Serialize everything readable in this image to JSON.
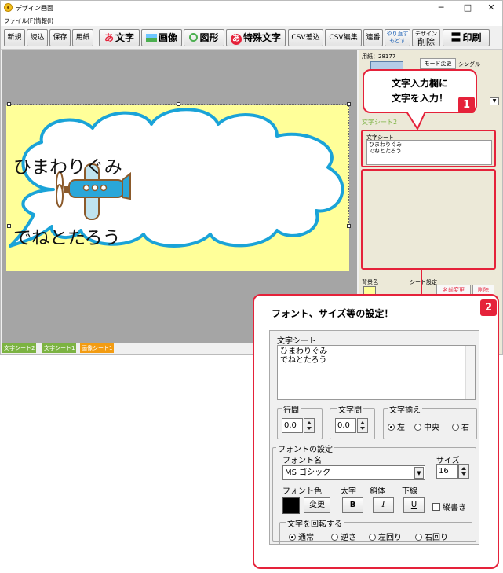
{
  "window": {
    "title": "デザイン画面",
    "controls": {
      "minimize": "─",
      "maximize": "□",
      "close": "✕"
    }
  },
  "menu": {
    "items": [
      "ファイル(F)",
      "情報(I)"
    ]
  },
  "toolbar": {
    "new": "新規",
    "load": "読込",
    "save": "保存",
    "paper": "用紙",
    "text": "文字",
    "image": "画像",
    "shape": "図形",
    "special_text": "特殊文字",
    "csv_insert": "CSV差込",
    "csv_edit": "CSV編集",
    "serial": "連番",
    "undo": "やり直す",
    "redo": "もどす",
    "design": "デザイン",
    "delete": "削除",
    "print": "印刷"
  },
  "canvas": {
    "text_lines": [
      "ひまわりぐみ",
      "でねとたろう"
    ]
  },
  "sheet_tabs": [
    {
      "label": "文字シート2",
      "color": "#7cb342"
    },
    {
      "label": "文字シート1",
      "color": "#7cb342"
    },
    {
      "label": "画像シート1",
      "color": "#f39c12"
    }
  ],
  "right_panel": {
    "paper_label": "用紙：28177",
    "mode_change": "モード変更",
    "single": "シングル",
    "sheet_name": "文字シート2",
    "text_sheet_label": "文字シート",
    "text_lines": [
      "ひまわりぐみ",
      "でねとたろう"
    ],
    "bg_color": "背景色",
    "sheet_settings": "シート設定",
    "rename": "名前変更",
    "delete": "削除"
  },
  "callout1": {
    "line1": "文字入力欄に",
    "line2": "文字を入力！",
    "badge": "1"
  },
  "zoom": {
    "title": "フォント、サイズ等の設定！",
    "badge": "2",
    "text_sheet_label": "文字シート",
    "text_value": "ひまわりぐみ\nでねとたろう",
    "line_spacing_label": "行間",
    "line_spacing_value": "0.0",
    "char_spacing_label": "文字間",
    "char_spacing_value": "0.0",
    "align_label": "文字揃え",
    "align_options": [
      "左",
      "中央",
      "右"
    ],
    "align_selected": "左",
    "font_settings_label": "フォントの設定",
    "font_name_label": "フォント名",
    "font_name_value": "MS ゴシック",
    "size_label": "サイズ",
    "size_value": "16",
    "font_color_label": "フォント色",
    "font_color_value": "#000000",
    "change_button": "変更",
    "bold_label": "太字",
    "bold_button": "B",
    "italic_label": "斜体",
    "italic_button": "I",
    "underline_label": "下線",
    "underline_button": "U",
    "vertical_label": "縦書き",
    "rotate_label": "文字を回転する",
    "rotate_options": [
      "通常",
      "逆さ",
      "左回り",
      "右回り"
    ],
    "rotate_selected": "通常"
  },
  "colors": {
    "accent_red": "#e5223a",
    "cloud_blue": "#1aa3d8",
    "page_yellow": "#ffff99",
    "canvas_gray": "#a5a5a5"
  }
}
